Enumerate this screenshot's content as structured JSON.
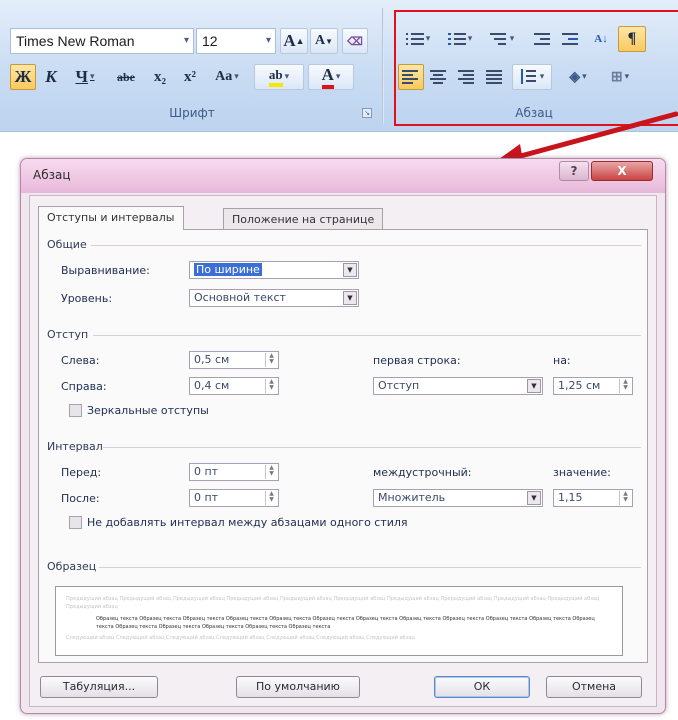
{
  "ribbon": {
    "font_group": {
      "font_name": "Times New Roman",
      "font_size": "12",
      "label": "Шрифт",
      "grow_label": "A",
      "shrink_label": "A",
      "bold": "Ж",
      "italic": "К",
      "underline": "Ч",
      "strike": "abe",
      "subscript": "x₂",
      "superscript": "x²",
      "change_case": "Aa",
      "highlight": "ab",
      "font_color": "A"
    },
    "paragraph_group": {
      "label": "Абзац",
      "show_marks": "¶"
    }
  },
  "dialog": {
    "title": "Абзац",
    "help_label": "?",
    "close_label": "X",
    "tabs": [
      "Отступы и интервалы",
      "Положение на странице"
    ],
    "general": {
      "title": "Общие",
      "alignment_label": "Выравнивание:",
      "alignment_value": "По ширине",
      "level_label": "Уровень:",
      "level_value": "Основной текст"
    },
    "indent": {
      "title": "Отступ",
      "left_label": "Слева:",
      "left_value": "0,5 см",
      "right_label": "Справа:",
      "right_value": "0,4 см",
      "first_line_label": "первая строка:",
      "first_line_value": "Отступ",
      "by_label": "на:",
      "by_value": "1,25 см",
      "mirror_label": "Зеркальные отступы"
    },
    "spacing": {
      "title": "Интервал",
      "before_label": "Перед:",
      "before_value": "0 пт",
      "after_label": "После:",
      "after_value": "0 пт",
      "line_label": "междустрочный:",
      "line_value": "Множитель",
      "at_label": "значение:",
      "at_value": "1,15",
      "dont_add_label": "Не добавлять интервал между абзацами одного стиля"
    },
    "preview": {
      "title": "Образец",
      "prev_text": "Предыдущий абзац Предыдущий абзац Предыдущий абзац Предыдущий абзац Предыдущий абзац Предыдущий абзац Предыдущий абзац Предыдущий абзац Предыдущий абзац Предыдущий абзац Предыдущий абзац",
      "sample_text": "Образец текста Образец текста Образец текста Образец текста Образец текста Образец текста Образец текста Образец текста Образец текста Образец текста Образец текста Образец текста Образец текста Образец текста Образец текста Образец текста Образец текста",
      "next_text": "Следующий абзац Следующий абзац Следующий абзац Следующий абзац Следующий абзац Следующий абзац Следующий абзац"
    },
    "buttons": {
      "tabs": "Табуляция...",
      "default": "По умолчанию",
      "ok": "ОК",
      "cancel": "Отмена"
    }
  },
  "colors": {
    "highlight_box": "#e0111a",
    "arrow": "#c8141a",
    "selection": "#3b6fd6"
  }
}
